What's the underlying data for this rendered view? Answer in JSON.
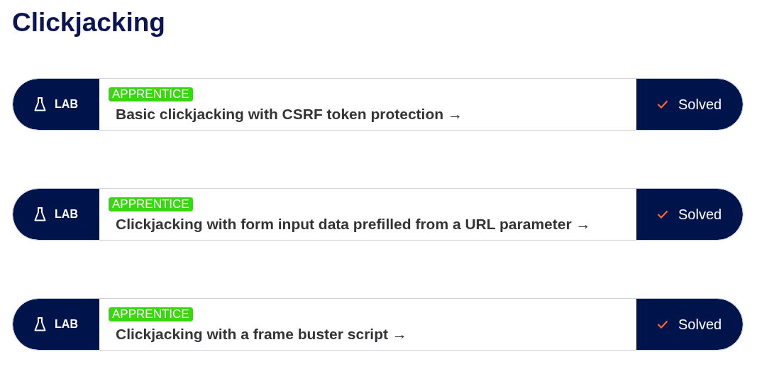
{
  "heading": "Clickjacking",
  "labs": [
    {
      "type_label": "LAB",
      "level": "APPRENTICE",
      "title": "Basic clickjacking with CSRF token protection →",
      "status": "Solved"
    },
    {
      "type_label": "LAB",
      "level": "APPRENTICE",
      "title": "Clickjacking with form input data prefilled from a URL parameter →",
      "status": "Solved"
    },
    {
      "type_label": "LAB",
      "level": "APPRENTICE",
      "title": "Clickjacking with a frame buster script →",
      "status": "Solved"
    }
  ]
}
